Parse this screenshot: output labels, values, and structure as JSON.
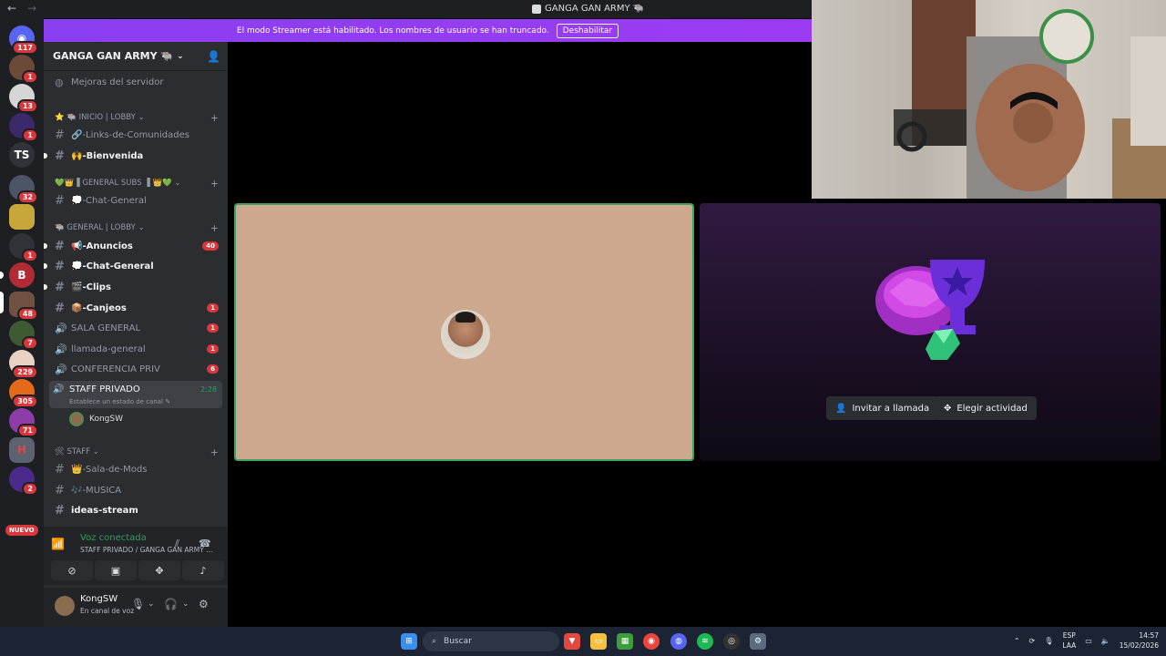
{
  "window": {
    "title": "GANGA GAN ARMY 🐃"
  },
  "banner": {
    "text": "El modo Streamer está habilitado. Los nombres de usuario se han truncado.",
    "button": "Deshabilitar"
  },
  "rail": {
    "home_badge": "117",
    "initials": "TS",
    "new_label": "NUEVO",
    "badges": [
      "1",
      "13",
      "1",
      "32",
      "1",
      "48",
      "7",
      "229",
      "305",
      "71",
      "2"
    ]
  },
  "server": {
    "name": "GANGA GAN ARMY 🐃",
    "boost": "Mejoras del servidor"
  },
  "categories": [
    {
      "label": "⭐ 🐃 INICIO | LOBBY"
    },
    {
      "label": "💚👑▐ GENERAL SUBS ▐ 👑💚"
    },
    {
      "label": "🐃 GENERAL | LOBBY"
    },
    {
      "label": "🛠 STAFF"
    }
  ],
  "channels": [
    {
      "name": "🔗-Links-de-Comunidades"
    },
    {
      "name": "🙌-Bienvenida"
    },
    {
      "name": "💭-Chat-General"
    },
    {
      "name": "📢-Anuncios",
      "count": "40"
    },
    {
      "name": "💭-Chat-General"
    },
    {
      "name": "🎬-Clips"
    },
    {
      "name": "📦-Canjeos",
      "count": "1"
    },
    {
      "name": "SALA GENERAL",
      "count": "1"
    },
    {
      "name": "llamada-general",
      "count": "1"
    },
    {
      "name": "CONFERENCIA PRIV",
      "count": "6"
    },
    {
      "name": "STAFF PRIVADO",
      "status": "Establece un estado de canal ✎",
      "time": "2:28"
    },
    {
      "name": "👑-Sala-de-Mods"
    },
    {
      "name": "🎶-MUSICA"
    },
    {
      "name": "ideas-stream"
    }
  ],
  "member": {
    "name": "KongSW"
  },
  "voice": {
    "status": "Voz conectada",
    "channel": "STAFF PRIVADO / GANGA GAN ARMY ..."
  },
  "user": {
    "name": "KongSW",
    "status": "En canal de voz"
  },
  "call": {
    "invite": "Invitar a llamada",
    "activity": "Elegir actividad"
  },
  "taskbar": {
    "search": "Buscar",
    "lang_top": "ESP",
    "lang_bottom": "LAA",
    "time": "14:57",
    "date": "15/02/2026"
  },
  "colors": {
    "accent": "#5865f2",
    "banner": "#9c3cf2",
    "online": "#23a559",
    "badge": "#da373c"
  }
}
